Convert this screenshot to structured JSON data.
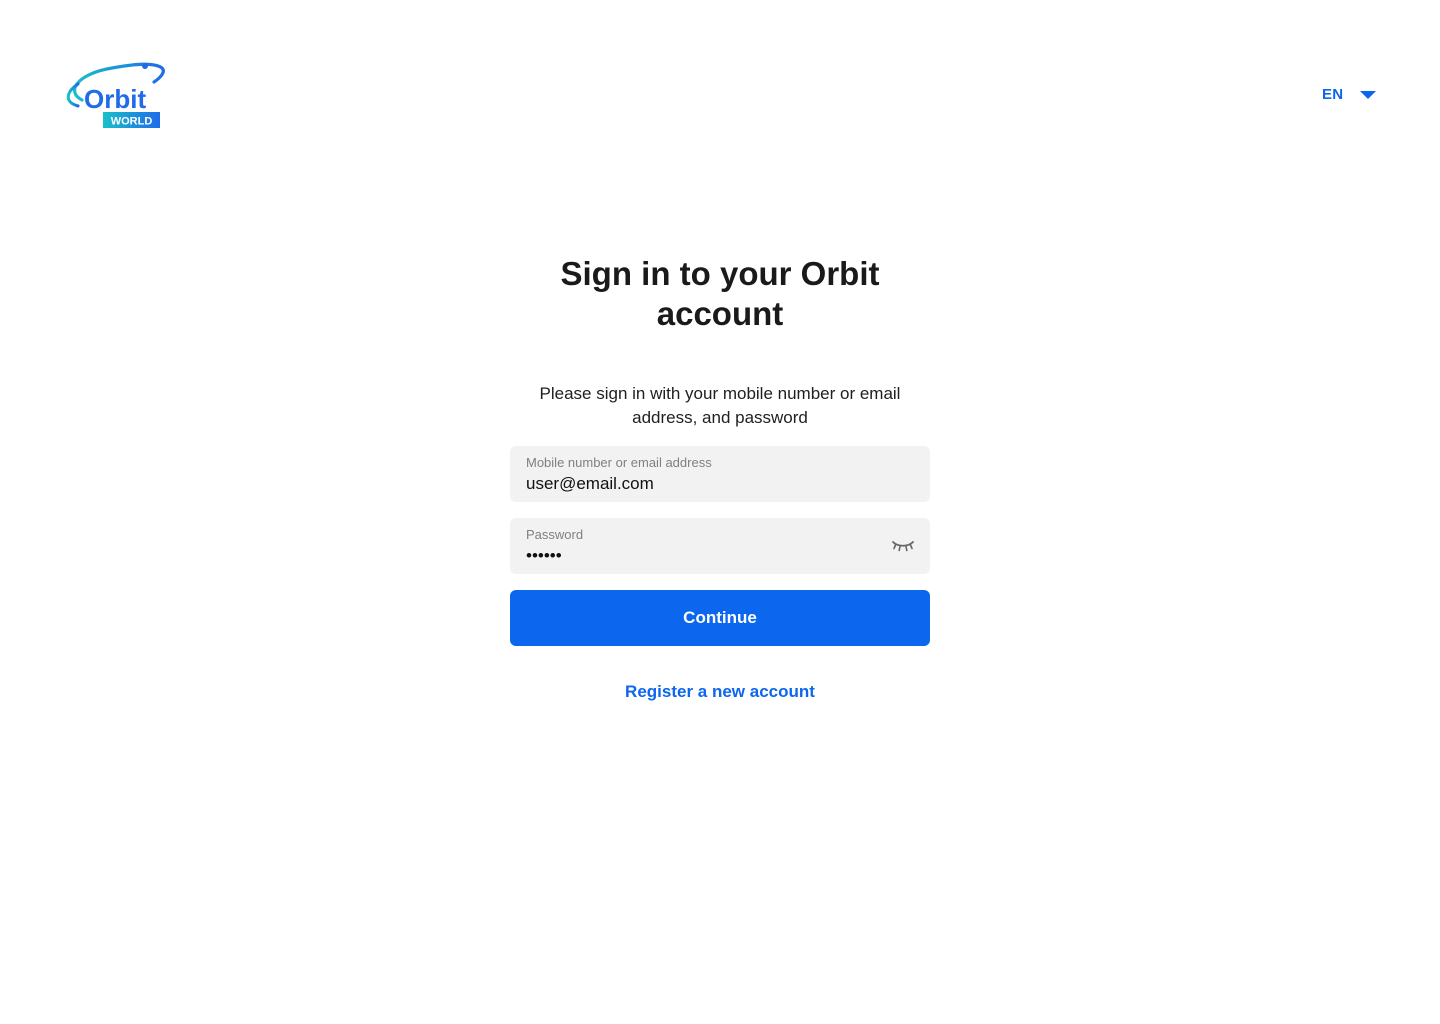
{
  "header": {
    "logo_text": "Orbit",
    "logo_subtext": "WORLD",
    "language": "EN"
  },
  "main": {
    "title": "Sign in to your Orbit account",
    "subtitle": "Please sign in with your mobile number or email address, and password",
    "email_field": {
      "label": "Mobile number or email address",
      "value": "user@email.com"
    },
    "password_field": {
      "label": "Password",
      "value": "••••••"
    },
    "continue_label": "Continue",
    "register_label": "Register a new account"
  },
  "colors": {
    "accent": "#0c66ee",
    "field_bg": "#f2f2f2",
    "logo_gradient_start": "#19c0c9",
    "logo_gradient_end": "#1f6be8"
  },
  "icons": {
    "language_caret": "chevron-down-icon",
    "password_toggle": "eye-closed-icon"
  }
}
